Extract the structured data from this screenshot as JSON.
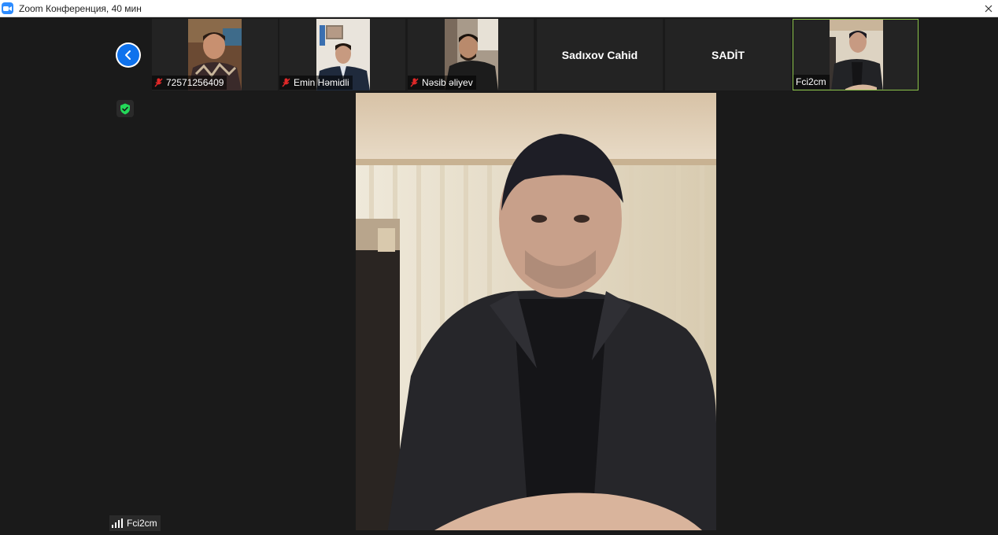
{
  "window": {
    "title": "Zoom Конференция, 40 мин"
  },
  "participants": [
    {
      "name": "72571256409",
      "muted": true,
      "video": "on"
    },
    {
      "name": "Emin Həmidli",
      "muted": true,
      "video": "on"
    },
    {
      "name": "Nəsib əliyev",
      "muted": true,
      "video": "on"
    },
    {
      "name": "Sadıxov Cahid",
      "muted": false,
      "video": "off"
    },
    {
      "name": "SADİT",
      "muted": false,
      "video": "off"
    },
    {
      "name": "Fci2cm",
      "muted": false,
      "video": "on",
      "active_speaker": true
    }
  ],
  "main_speaker": {
    "name": "Fci2cm"
  },
  "colors": {
    "accent_blue": "#0e72ed",
    "active_border": "#8bc34a",
    "muted_red": "#e02828",
    "shield_green": "#23d959",
    "background": "#1a1a1a"
  },
  "icons": {
    "back": "chevron-left-icon",
    "mute": "mic-muted-icon",
    "security": "shield-check-icon",
    "signal": "signal-bars-icon",
    "app": "zoom-camera-icon"
  }
}
